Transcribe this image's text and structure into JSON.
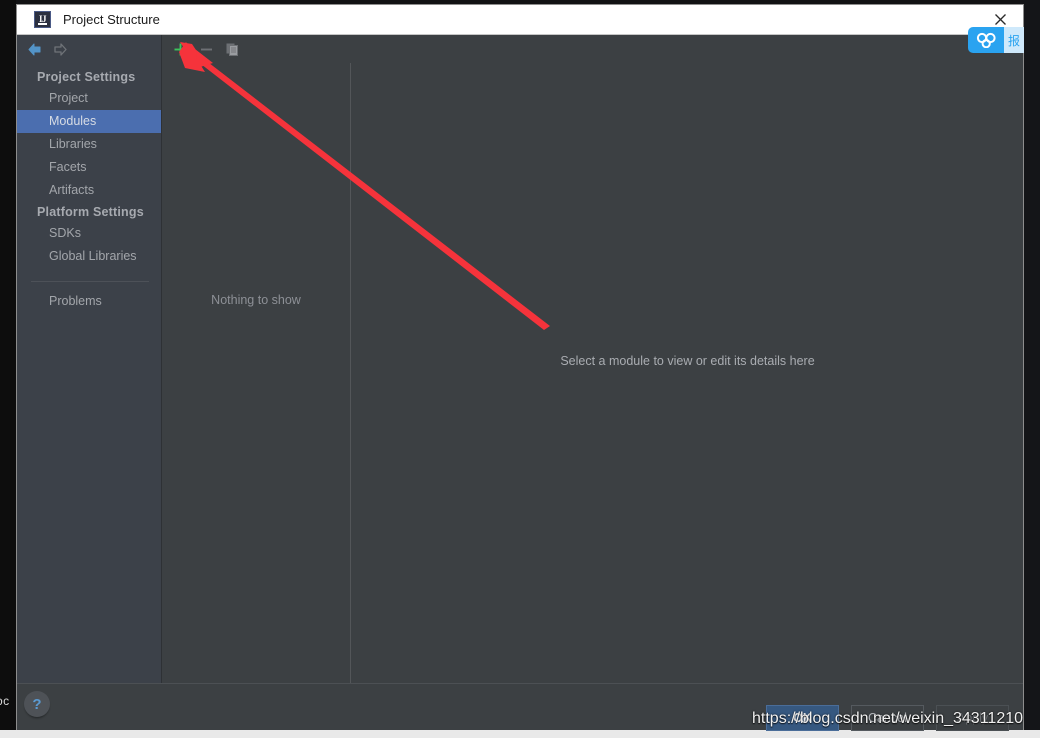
{
  "window": {
    "title": "Project Structure",
    "app_icon": "intellij-idea-icon",
    "icon_text": "IJ",
    "close_label": "×"
  },
  "navigation": {
    "back_icon": "arrow-left-icon",
    "forward_icon": "arrow-right-icon"
  },
  "sidebar": {
    "groups": [
      {
        "label": "Project Settings",
        "items": [
          {
            "label": "Project",
            "selected": false
          },
          {
            "label": "Modules",
            "selected": true
          },
          {
            "label": "Libraries",
            "selected": false
          },
          {
            "label": "Facets",
            "selected": false
          },
          {
            "label": "Artifacts",
            "selected": false
          }
        ]
      },
      {
        "label": "Platform Settings",
        "items": [
          {
            "label": "SDKs",
            "selected": false
          },
          {
            "label": "Global Libraries",
            "selected": false
          }
        ]
      }
    ],
    "extra_items": [
      {
        "label": "Problems",
        "selected": false
      }
    ]
  },
  "toolbar": {
    "add": {
      "icon": "plus-icon",
      "label": "+",
      "enabled": true
    },
    "remove": {
      "icon": "minus-icon",
      "label": "−",
      "enabled": false
    },
    "copy": {
      "icon": "copy-icon",
      "label": "",
      "enabled": false
    }
  },
  "module_list": {
    "empty_text": "Nothing to show"
  },
  "detail_panel": {
    "hint_text": "Select a module to view or edit its details here"
  },
  "footer": {
    "help_label": "?",
    "buttons": [
      {
        "label": "OK",
        "style": "primary"
      },
      {
        "label": "Cancel",
        "style": "normal"
      },
      {
        "label": "Apply",
        "style": "disabled"
      }
    ]
  },
  "overlay": {
    "watermark": "https://blog.csdn.net/weixin_34311210",
    "cloud_badge_icon": "baidu-cloud-icon",
    "cloud_badge_text": "报",
    "background_text": "oc",
    "annotation_arrow_color": "#f5333b"
  },
  "colors": {
    "accent": "#4b6eaf",
    "dialog_bg": "#3c4043",
    "sidebar_bg": "#3c4149",
    "primary_button": "#365880",
    "annotation": "#f5333b",
    "add_icon": "#3cc45c"
  }
}
